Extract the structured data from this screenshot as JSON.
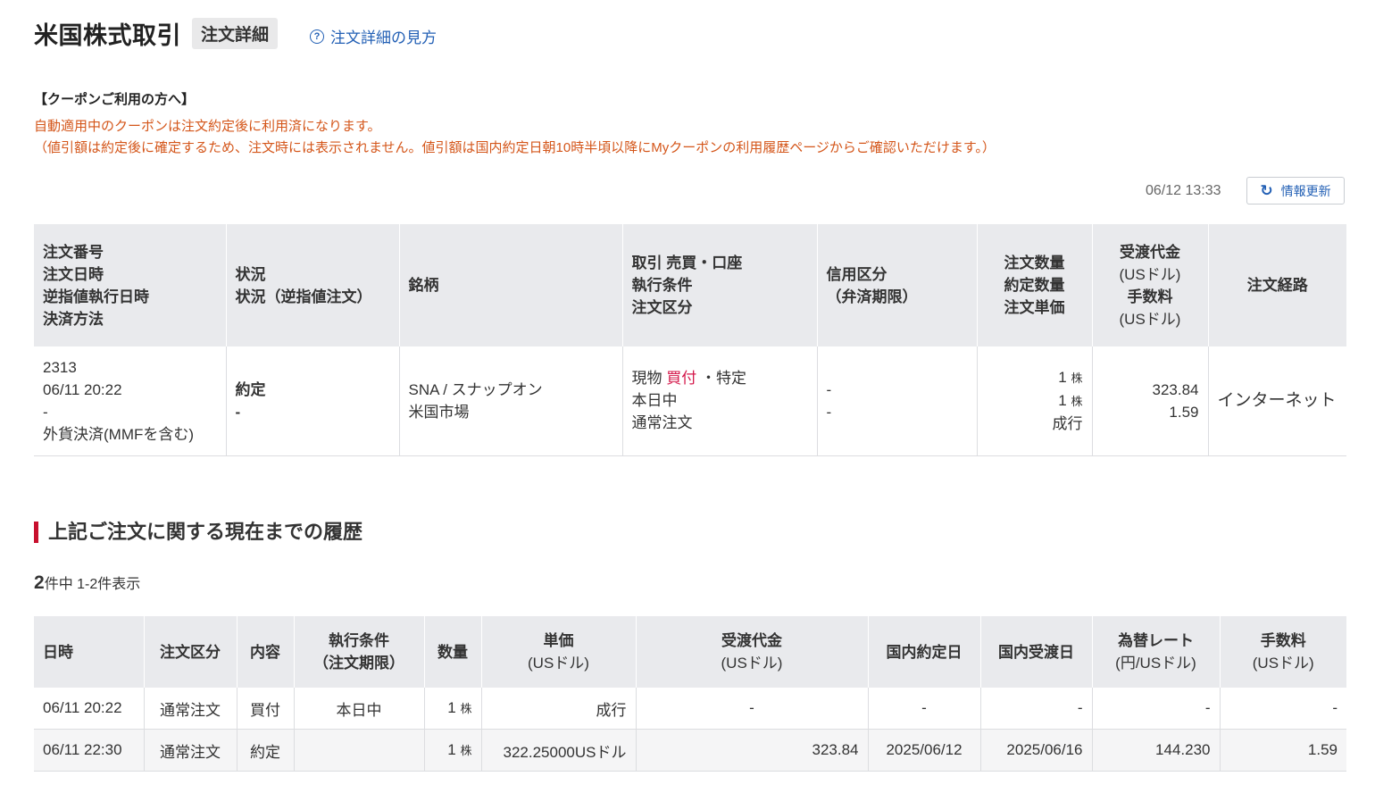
{
  "header": {
    "title": "米国株式取引",
    "tag": "注文詳細",
    "help_link": "注文詳細の見方",
    "help_icon": "question-circle-icon"
  },
  "coupon": {
    "heading": "【クーポンご利用の方へ】",
    "line1": "自動適用中のクーポンは注文約定後に利用済になります。",
    "line2": "（値引額は約定後に確定するため、注文時には表示されません。値引額は国内約定日朝10時半頃以降にMyクーポンの利用履歴ページからご確認いただけます。）"
  },
  "refresh": {
    "timestamp": "06/12 13:33",
    "label": "情報更新",
    "icon": "refresh-icon"
  },
  "order_table": {
    "headers": {
      "col1": [
        "注文番号",
        "注文日時",
        "逆指値執行日時",
        "決済方法"
      ],
      "col2": [
        "状況",
        "状況（逆指値注文）"
      ],
      "col3": "銘柄",
      "col4": [
        "取引 売買・口座",
        "執行条件",
        "注文区分"
      ],
      "col5": [
        "信用区分",
        "（弁済期限）"
      ],
      "col6": [
        "注文数量",
        "約定数量",
        "注文単価"
      ],
      "col7": [
        "受渡代金",
        "(USドル)",
        "手数料",
        "(USドル)"
      ],
      "col8": "注文経路"
    },
    "row": {
      "order_no": "2313",
      "order_datetime": "06/11 20:22",
      "stop_datetime": "-",
      "settlement": "外貨決済(MMFを含む)",
      "status": "約定",
      "stop_status": "-",
      "symbol": "SNA / スナップオン",
      "market": "米国市場",
      "trade_type": "現物",
      "side": "買付",
      "account": "・特定",
      "exec_condition": "本日中",
      "order_type": "通常注文",
      "margin_type": "-",
      "margin_deadline": "-",
      "order_qty": "1",
      "filled_qty": "1",
      "unit": "株",
      "order_price": "成行",
      "settlement_amount": "323.84",
      "commission": "1.59",
      "route": "インターネット"
    }
  },
  "history": {
    "section_title": "上記ご注文に関する現在までの履歴",
    "count_total": "2",
    "count_text": "件中 1-2件表示",
    "headers": {
      "datetime": "日時",
      "order_type": "注文区分",
      "content": "内容",
      "exec_condition": [
        "執行条件",
        "（注文期限）"
      ],
      "qty": "数量",
      "price": [
        "単価",
        "(USドル)"
      ],
      "amount": [
        "受渡代金",
        "(USドル)"
      ],
      "domestic_exec_date": "国内約定日",
      "domestic_settle_date": "国内受渡日",
      "fx_rate": [
        "為替レート",
        "(円/USドル)"
      ],
      "commission": [
        "手数料",
        "(USドル)"
      ]
    },
    "rows": [
      {
        "datetime": "06/11 20:22",
        "order_type": "通常注文",
        "content": "買付",
        "exec_condition": "本日中",
        "qty": "1",
        "unit": "株",
        "price": "成行",
        "amount": "-",
        "domestic_exec_date": "-",
        "domestic_settle_date": "-",
        "fx_rate": "-",
        "commission": "-"
      },
      {
        "datetime": "06/11 22:30",
        "order_type": "通常注文",
        "content": "約定",
        "exec_condition": "",
        "qty": "1",
        "unit": "株",
        "price": "322.25000USドル",
        "amount": "323.84",
        "domestic_exec_date": "2025/06/12",
        "domestic_settle_date": "2025/06/16",
        "fx_rate": "144.230",
        "commission": "1.59"
      }
    ]
  }
}
